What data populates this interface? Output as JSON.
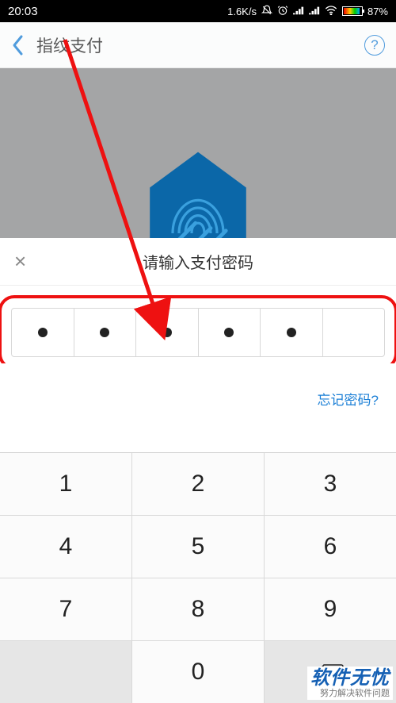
{
  "status": {
    "time": "20:03",
    "speed": "1.6K/s",
    "battery_pct": "87%"
  },
  "header": {
    "title": "指纹支付"
  },
  "sheet": {
    "title": "请输入支付密码",
    "forgot": "忘记密码?",
    "pin_filled": 5,
    "pin_total": 6
  },
  "keypad": {
    "k1": "1",
    "k2": "2",
    "k3": "3",
    "k4": "4",
    "k5": "5",
    "k6": "6",
    "k7": "7",
    "k8": "8",
    "k9": "9",
    "k0": "0"
  },
  "watermark": {
    "line1": "软件无忧",
    "line2": "努力解决软件问题"
  }
}
